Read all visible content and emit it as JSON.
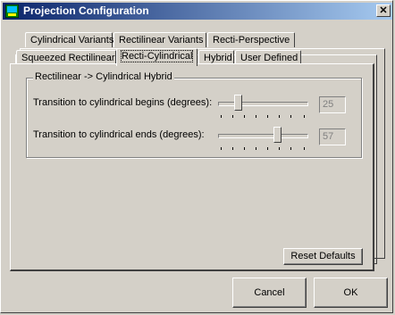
{
  "window": {
    "title": "Projection Configuration"
  },
  "tabs_row1": [
    "Cylindrical Variants",
    "Rectilinear Variants",
    "Recti-Perspective"
  ],
  "tabs_row2": [
    "Squeezed Rectilinear",
    "Recti-Cylindrical",
    "Hybrid",
    "User Defined"
  ],
  "active_tab": "Recti-Cylindrical",
  "group": {
    "label": "Rectilinear -> Cylindrical Hybrid",
    "rows": [
      {
        "label": "Transition to cylindrical begins (degrees):",
        "value": "25"
      },
      {
        "label": "Transition to cylindrical ends (degrees):",
        "value": "57"
      }
    ]
  },
  "buttons": {
    "reset": "Reset Defaults",
    "cancel": "Cancel",
    "ok": "OK"
  },
  "icons": {
    "close": "close-icon",
    "app": "app-icon"
  }
}
